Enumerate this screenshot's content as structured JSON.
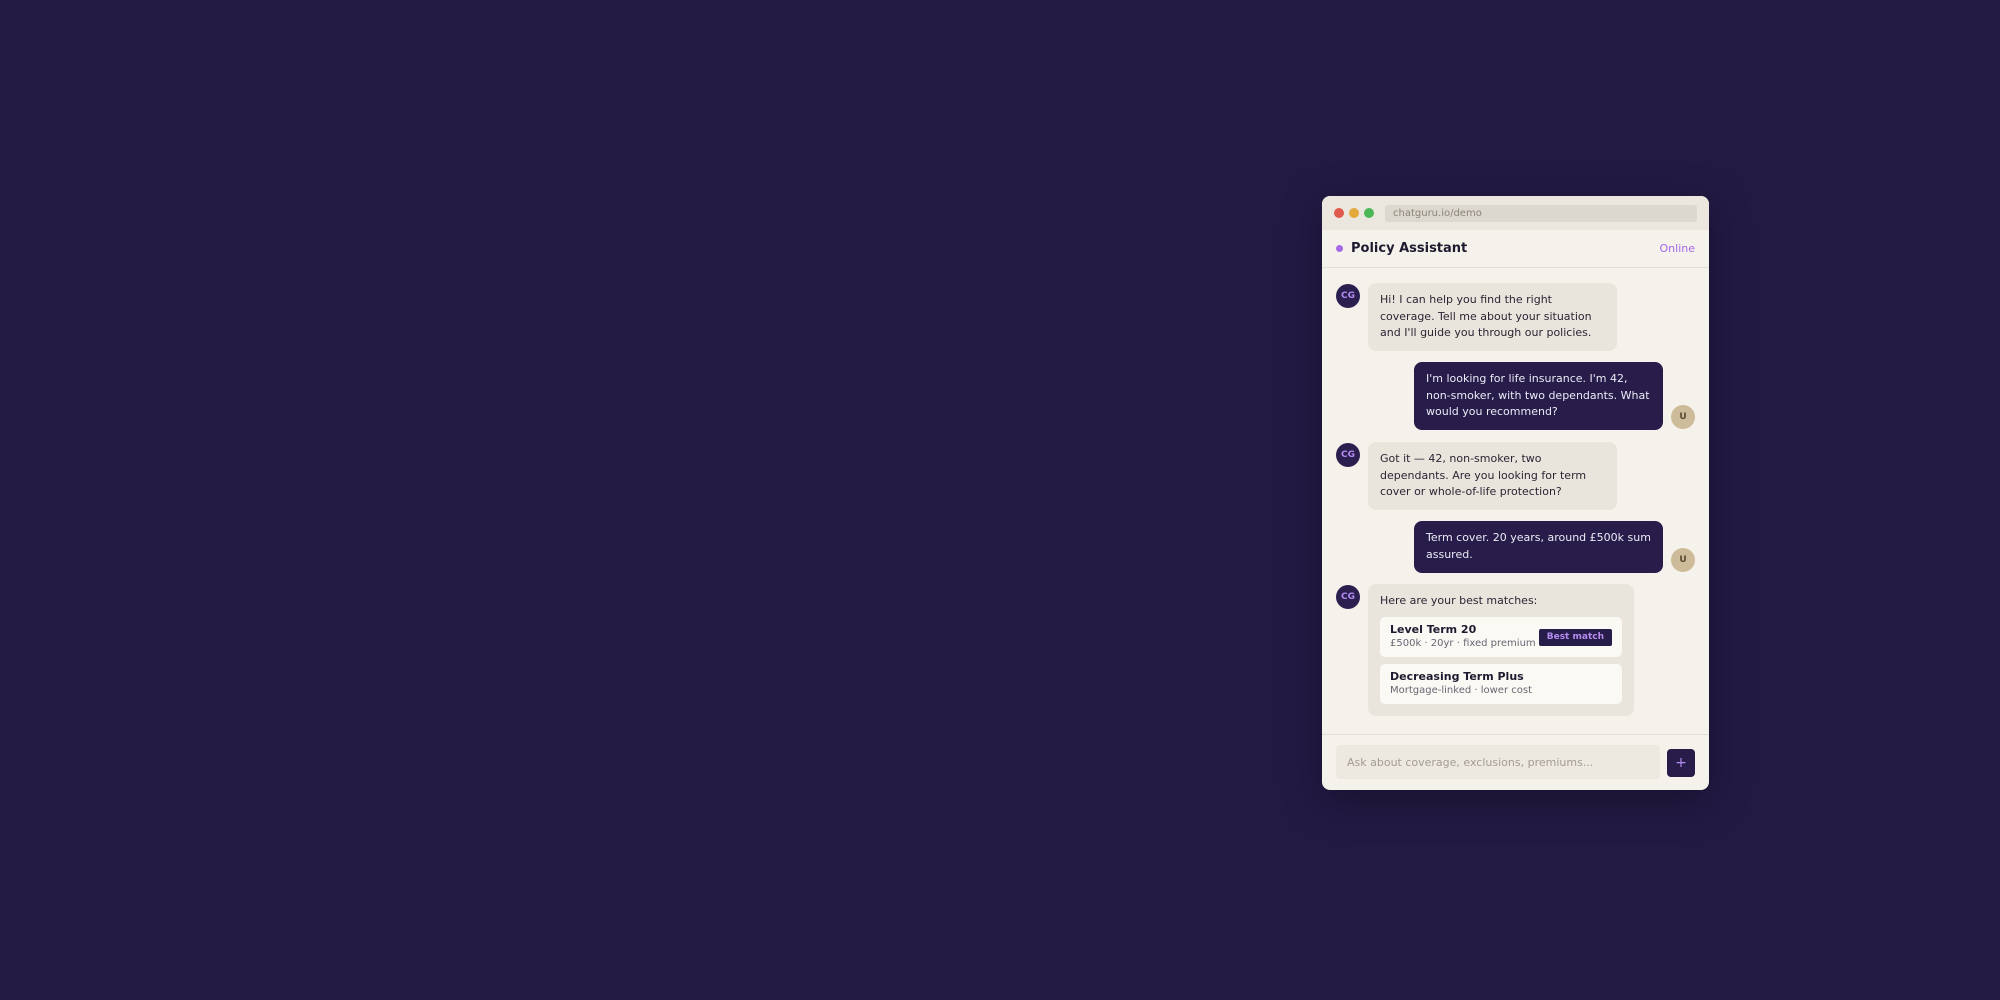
{
  "browser": {
    "url": "chatguru.io/demo"
  },
  "header": {
    "title": "Policy Assistant",
    "status": "Online"
  },
  "avatars": {
    "bot": "CG",
    "user": "U"
  },
  "messages": [
    {
      "role": "bot",
      "text": "Hi! I can help you find the right coverage. Tell me about your situation and I'll guide you through our policies."
    },
    {
      "role": "user",
      "text": "I'm looking for life insurance. I'm 42, non-smoker, with two dependants. What would you recommend?"
    },
    {
      "role": "bot",
      "text": "Got it — 42, non-smoker, two dependants. Are you looking for term cover or whole-of-life protection?"
    },
    {
      "role": "user",
      "text": "Term cover. 20 years, around £500k sum assured."
    },
    {
      "role": "bot",
      "text": "Here are your best matches:",
      "policies": [
        {
          "name": "Level Term 20",
          "details": "£500k · 20yr · fixed premium",
          "badge": "Best match"
        },
        {
          "name": "Decreasing Term Plus",
          "details": "Mortgage-linked · lower cost"
        }
      ]
    }
  ],
  "composer": {
    "placeholder": "Ask about coverage, exclusions, premiums...",
    "send_label": "+"
  },
  "colors": {
    "background": "#231a44",
    "accent": "#a667e8",
    "user_bubble": "#271c4a",
    "bot_bubble": "#e9e5dc"
  }
}
